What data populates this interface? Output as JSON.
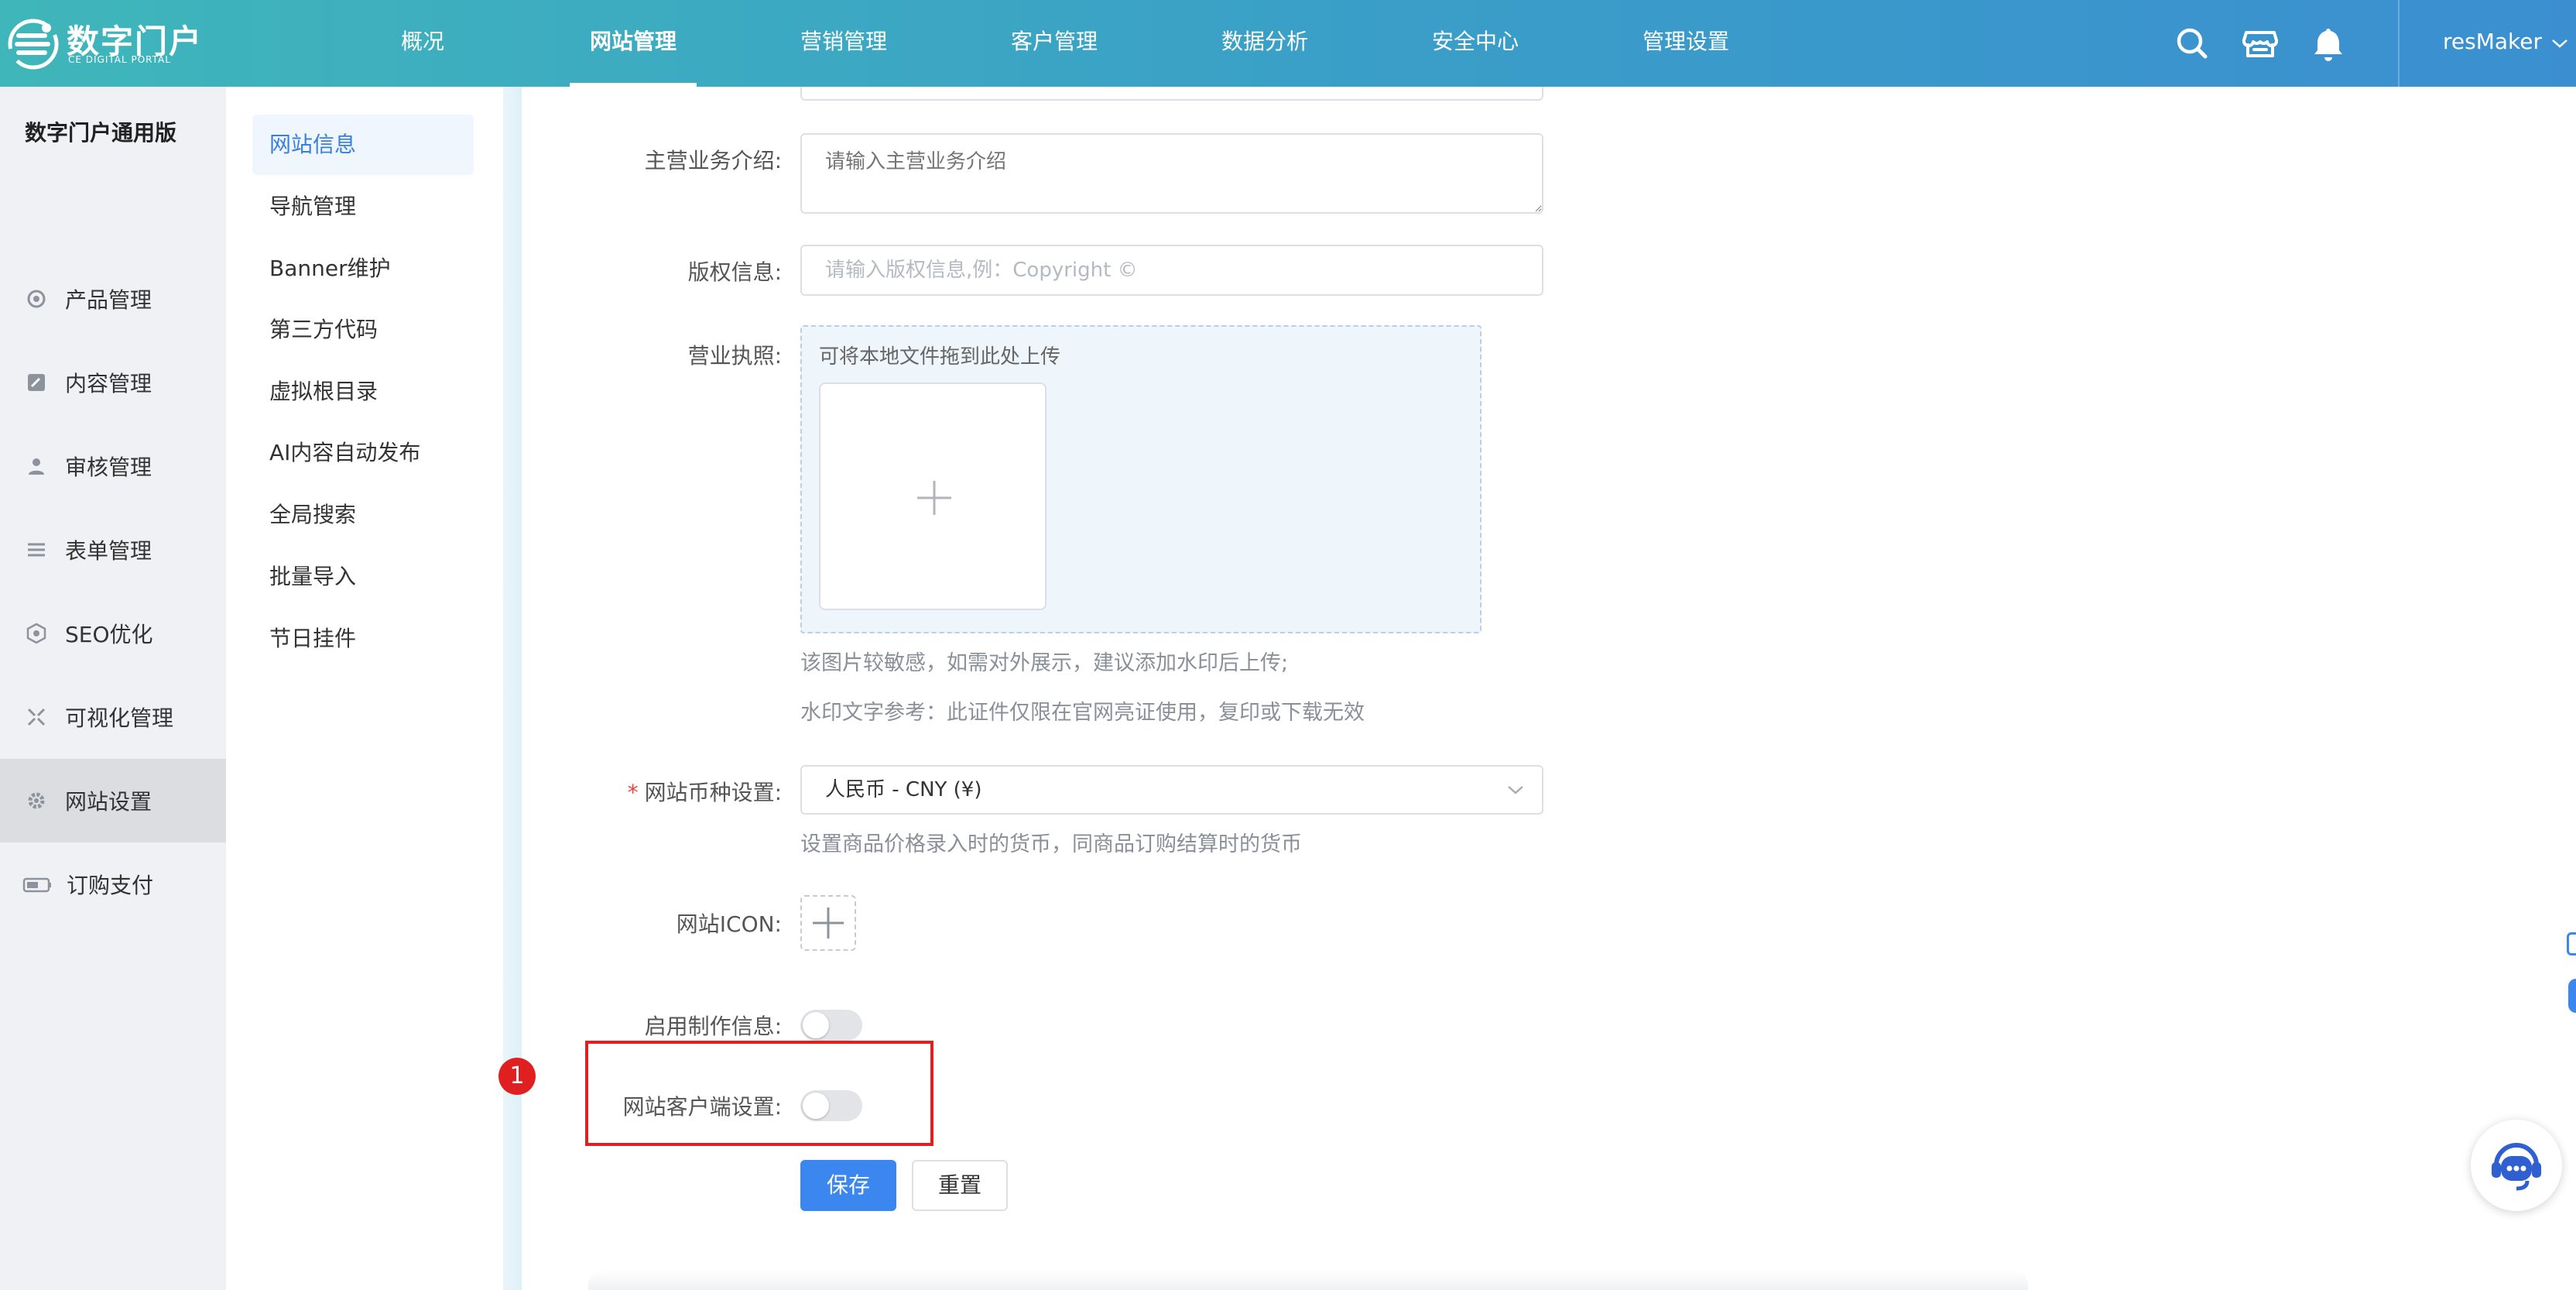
{
  "brand": {
    "title": "数字门户",
    "subtitle": "CE DIGITAL PORTAL"
  },
  "nav": {
    "items": [
      "概况",
      "网站管理",
      "营销管理",
      "客户管理",
      "数据分析",
      "安全中心",
      "管理设置"
    ],
    "active_index": 1
  },
  "header_icons": [
    "search-icon",
    "store-icon",
    "bell-icon"
  ],
  "user": {
    "name": "resMaker"
  },
  "sidebar": {
    "title": "数字门户通用版",
    "items": [
      {
        "label": "产品管理",
        "icon": "product-icon"
      },
      {
        "label": "内容管理",
        "icon": "content-icon"
      },
      {
        "label": "审核管理",
        "icon": "review-icon"
      },
      {
        "label": "表单管理",
        "icon": "form-icon"
      },
      {
        "label": "SEO优化",
        "icon": "seo-icon"
      },
      {
        "label": "可视化管理",
        "icon": "visual-icon"
      },
      {
        "label": "网站设置",
        "icon": "settings-icon",
        "active": true
      },
      {
        "label": "订购支付",
        "icon": "payment-icon"
      }
    ]
  },
  "submenu": {
    "items": [
      "网站信息",
      "导航管理",
      "Banner维护",
      "第三方代码",
      "虚拟根目录",
      "AI内容自动发布",
      "全局搜索",
      "批量导入",
      "节日挂件"
    ],
    "active_index": 0
  },
  "form": {
    "business_intro": {
      "label": "主营业务介绍:",
      "placeholder": "请输入主营业务介绍"
    },
    "copyright": {
      "label": "版权信息:",
      "placeholder": "请输入版权信息,例：Copyright ©"
    },
    "license": {
      "label": "营业执照:",
      "drop_hint": "可将本地文件拖到此处上传",
      "note1": "该图片较敏感，如需对外展示，建议添加水印后上传;",
      "note2": "水印文字参考：此证件仅限在官网亮证使用，复印或下载无效"
    },
    "currency": {
      "label": "网站币种设置:",
      "required_mark": "*",
      "value": "人民币 - CNY (¥)",
      "hint": "设置商品价格录入时的货币，同商品订购结算时的货币"
    },
    "icon": {
      "label": "网站ICON:"
    },
    "producer_info": {
      "label": "启用制作信息:",
      "enabled": false
    },
    "client_setting": {
      "label": "网站客户端设置:",
      "enabled": false
    },
    "buttons": {
      "save": "保存",
      "reset": "重置"
    }
  },
  "annotation": {
    "number": "1",
    "color": "#e02020"
  },
  "colors": {
    "primary": "#3c86f0",
    "topbar_start": "#3fb6ba",
    "topbar_end": "#3b8fd0",
    "highlight": "#e02020"
  }
}
